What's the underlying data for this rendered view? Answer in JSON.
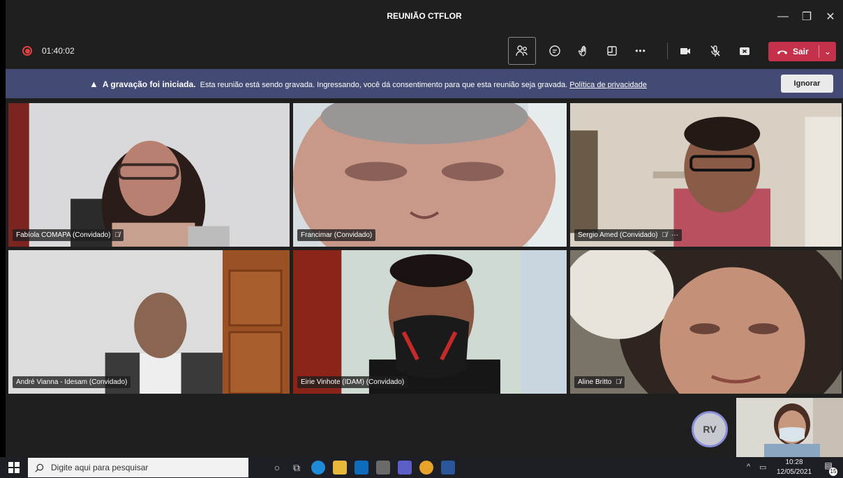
{
  "window": {
    "title": "REUNIÃO CTFLOR",
    "controls": [
      {
        "name": "minimize-icon",
        "glyph": "—"
      },
      {
        "name": "maximize-icon",
        "glyph": "❐"
      },
      {
        "name": "close-icon",
        "glyph": "✕"
      }
    ]
  },
  "toolbar": {
    "timer": "01:40:02",
    "more_glyph": "•••",
    "leave_label": "Sair",
    "leave_chevron": "⌄"
  },
  "banner": {
    "warning_glyph": "▲",
    "title": "A gravação foi iniciada.",
    "message": "Esta reunião está sendo gravada. Ingressando, você dá consentimento para que esta reunião seja gravada.",
    "link": "Política de privacidade",
    "dismiss_label": "Ignorar"
  },
  "participants": [
    {
      "name": "Fabíola COMAPA (Convidado)",
      "muted": true
    },
    {
      "name": "Francimar (Convidado)",
      "muted": false
    },
    {
      "name": "Sergio Amed (Convidado)",
      "muted": true,
      "more": "···"
    },
    {
      "name": "André Vianna - Idesam (Convidado)",
      "muted": false
    },
    {
      "name": "Eirie Vinhote (IDAM) (Convidado)",
      "muted": false
    },
    {
      "name": "Aline Britto",
      "muted": true
    }
  ],
  "avatar": {
    "initials": "RV"
  },
  "taskbar": {
    "search_placeholder": "Digite aqui para pesquisar",
    "tray_chevron": "^",
    "time": "10:28",
    "date": "12/05/2021",
    "notifications": "15"
  },
  "colors": {
    "background": "#1f1f1f",
    "banner": "#434b74",
    "leave_button": "#c4314b",
    "recording": "#e04040",
    "avatar_ring": "#8a8ed8"
  }
}
